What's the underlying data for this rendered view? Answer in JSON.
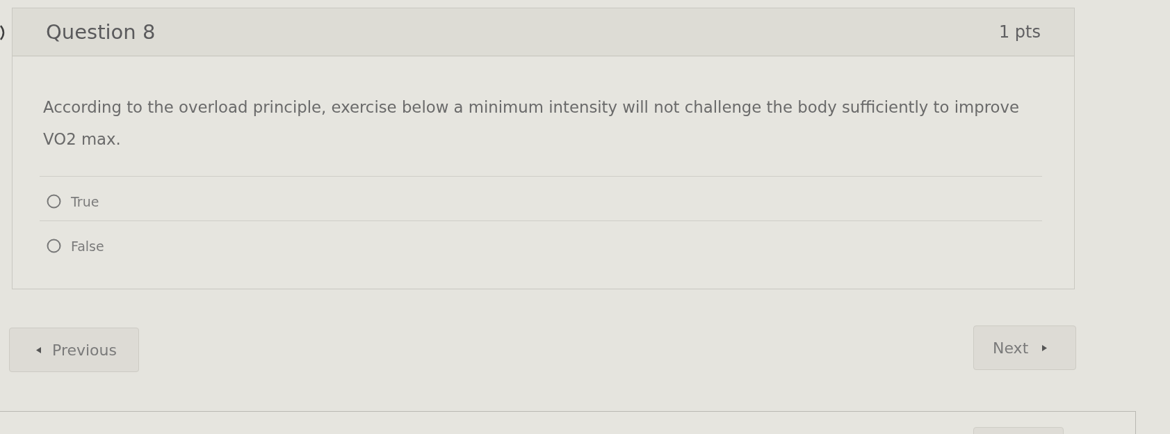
{
  "question": {
    "title": "Question 8",
    "points": "1 pts",
    "text": "According to the overload principle, exercise below a minimum intensity will not challenge the body sufficiently to improve VO2 max.",
    "answers": [
      {
        "label": "True",
        "selected": false
      },
      {
        "label": "False",
        "selected": false
      }
    ]
  },
  "navigation": [
    {
      "kind": "previous",
      "label": "Previous"
    },
    {
      "kind": "next",
      "label": "Next"
    }
  ]
}
